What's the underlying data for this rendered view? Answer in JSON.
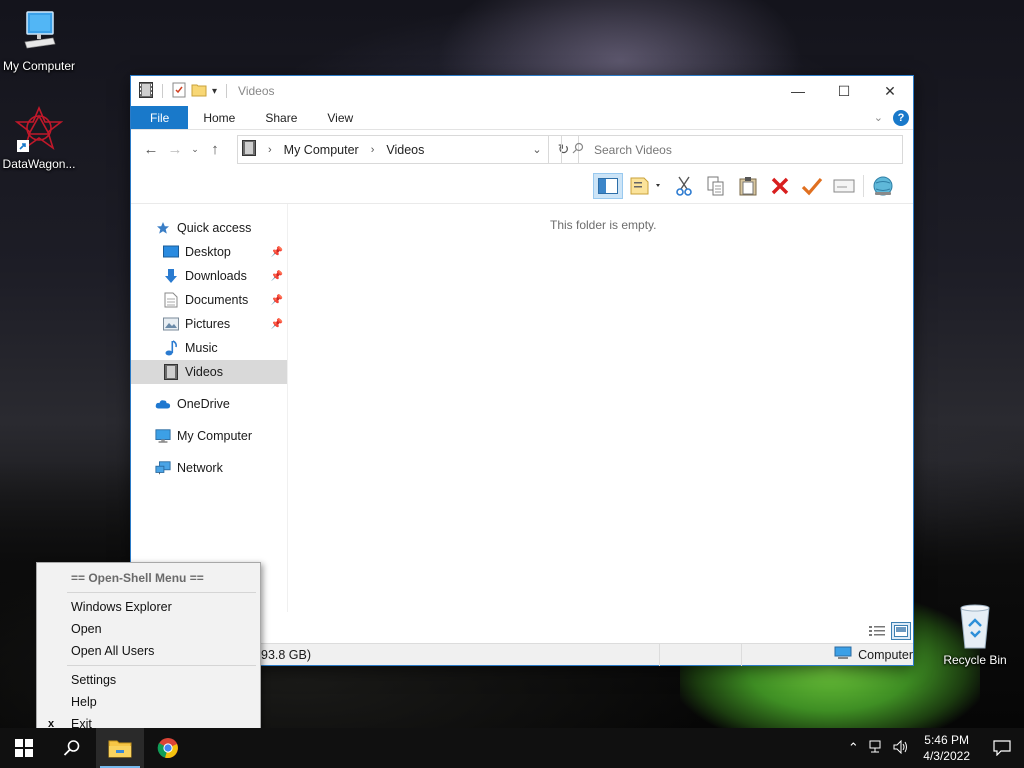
{
  "desktop": {
    "icons": [
      {
        "label": "My Computer"
      },
      {
        "label": "DataWagon..."
      },
      {
        "label": "Recycle Bin"
      }
    ]
  },
  "window": {
    "title": "Videos",
    "tabs": {
      "file": "File",
      "home": "Home",
      "share": "Share",
      "view": "View"
    },
    "address": {
      "root": "My Computer",
      "current": "Videos"
    },
    "search_placeholder": "Search Videos",
    "sidebar": {
      "quick_access": "Quick access",
      "items": [
        {
          "label": "Desktop"
        },
        {
          "label": "Downloads"
        },
        {
          "label": "Documents"
        },
        {
          "label": "Pictures"
        },
        {
          "label": "Music"
        },
        {
          "label": "Videos"
        }
      ],
      "onedrive": "OneDrive",
      "my_computer": "My Computer",
      "network": "Network"
    },
    "empty_message": "This folder is empty.",
    "status": {
      "free_space": "93.8 GB)",
      "location": "Computer"
    }
  },
  "context_menu": {
    "header": "== Open-Shell Menu ==",
    "items": [
      "Windows Explorer",
      "Open",
      "Open All Users",
      "Settings",
      "Help",
      "Exit"
    ],
    "exit_mark": "x"
  },
  "taskbar": {
    "time": "5:46 PM",
    "date": "4/3/2022"
  },
  "colors": {
    "accent": "#1979ca",
    "selection": "#d9d9d9",
    "taskbar": "#101010"
  }
}
